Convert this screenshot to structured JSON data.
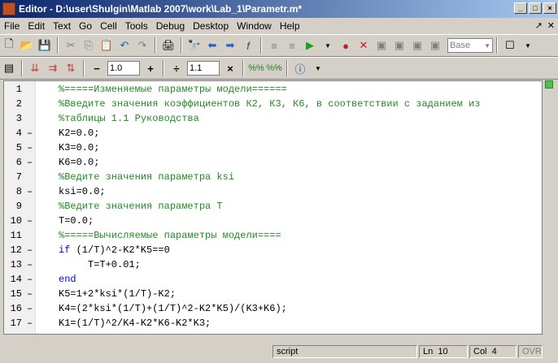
{
  "window": {
    "title": "Editor - D:\\user\\Shulgin\\Matlab 2007\\work\\Lab_1\\Parametr.m*"
  },
  "menu": [
    {
      "label": "File",
      "key": "F"
    },
    {
      "label": "Edit",
      "key": "E"
    },
    {
      "label": "Text",
      "key": "T"
    },
    {
      "label": "Go",
      "key": "G"
    },
    {
      "label": "Cell",
      "key": "C"
    },
    {
      "label": "Tools",
      "key": "o"
    },
    {
      "label": "Debug",
      "key": "b"
    },
    {
      "label": "Desktop",
      "key": "D"
    },
    {
      "label": "Window",
      "key": "W"
    },
    {
      "label": "Help",
      "key": "H"
    }
  ],
  "toolbar": {
    "base_label": "Base",
    "decrement_value": "1.0",
    "divide_value": "1.1"
  },
  "editor": {
    "lines": [
      {
        "n": "1",
        "dash": "",
        "cls": "c-comment",
        "text": "%=====Изменяемые параметры модели======"
      },
      {
        "n": "2",
        "dash": "",
        "cls": "c-comment",
        "text": "%Введите значения коэффициентов К2, К3, К6, в соответствии с заданием из"
      },
      {
        "n": "3",
        "dash": "",
        "cls": "c-comment",
        "text": "%таблицы 1.1 Руководства"
      },
      {
        "n": "4",
        "dash": "–",
        "cls": "c-plain",
        "text": "K2=0.0;"
      },
      {
        "n": "5",
        "dash": "–",
        "cls": "c-plain",
        "text": "K3=0.0;"
      },
      {
        "n": "6",
        "dash": "–",
        "cls": "c-plain",
        "text": "K6=0.0;"
      },
      {
        "n": "7",
        "dash": "",
        "cls": "c-comment",
        "text": "%Ведите значения параметра ksi"
      },
      {
        "n": "8",
        "dash": "–",
        "cls": "c-plain",
        "text": "ksi=0.0;"
      },
      {
        "n": "9",
        "dash": "",
        "cls": "c-comment",
        "text": "%Ведите значения параметра T"
      },
      {
        "n": "10",
        "dash": "–",
        "cls": "c-plain",
        "text": "T=0.0;"
      },
      {
        "n": "11",
        "dash": "",
        "cls": "c-comment",
        "text": "%=====Вычисляемые параметры модели===="
      },
      {
        "n": "12",
        "dash": "–",
        "cls": "c-plain",
        "kw": "if",
        "text": " (1/T)^2-K2*K5==0"
      },
      {
        "n": "13",
        "dash": "–",
        "cls": "c-plain",
        "text": "     T=T+0.01;"
      },
      {
        "n": "14",
        "dash": "–",
        "cls": "c-keyword",
        "text": "end"
      },
      {
        "n": "15",
        "dash": "–",
        "cls": "c-plain",
        "text": "K5=1+2*ksi*(1/T)-K2;"
      },
      {
        "n": "16",
        "dash": "–",
        "cls": "c-plain",
        "text": "K4=(2*ksi*(1/T)+(1/T)^2-K2*K5)/(K3+K6);"
      },
      {
        "n": "17",
        "dash": "–",
        "cls": "c-plain",
        "text": "K1=(1/T)^2/K4-K2*K6-K2*K3;"
      }
    ]
  },
  "status": {
    "mode": "script",
    "ln_label": "Ln",
    "ln_value": "10",
    "col_label": "Col",
    "col_value": "4",
    "ovr": "OVR"
  },
  "colors": {
    "comment": "#228b22",
    "keyword": "#0000ff",
    "title_bar": "#0a246a"
  }
}
